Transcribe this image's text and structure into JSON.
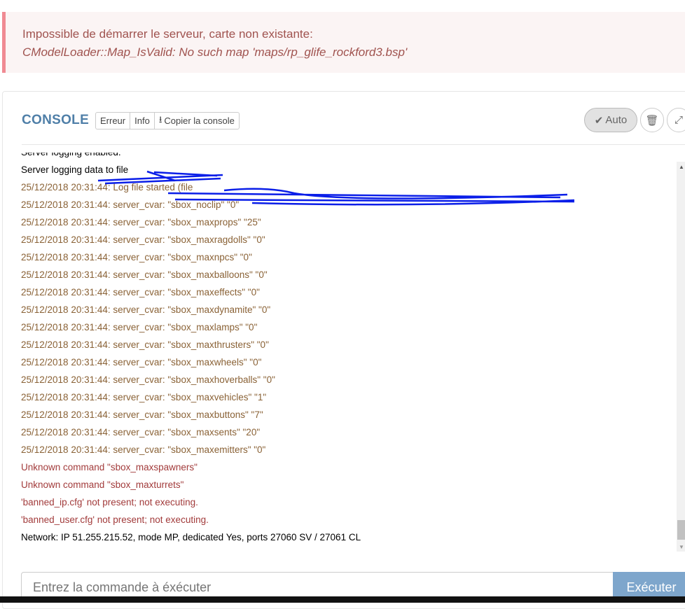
{
  "alert": {
    "message": "Impossible de démarrer le serveur, carte non existante:",
    "detail": "CModelLoader::Map_IsValid: No such map 'maps/rp_glife_rockford3.bsp'"
  },
  "console": {
    "title": "CONSOLE",
    "filters": {
      "error": "Erreur",
      "info": "Info",
      "copy": "Copier la console"
    },
    "auto_label": "Auto",
    "lines": [
      {
        "text": "Server logging enabled.",
        "type": "info"
      },
      {
        "text": "Server logging data to file",
        "type": "info"
      },
      {
        "text": "25/12/2018 20:31:44: Log file started (file",
        "type": "warn"
      },
      {
        "text": "25/12/2018 20:31:44: server_cvar: \"sbox_noclip\" \"0\"",
        "type": "warn"
      },
      {
        "text": "25/12/2018 20:31:44: server_cvar: \"sbox_maxprops\" \"25\"",
        "type": "warn"
      },
      {
        "text": "25/12/2018 20:31:44: server_cvar: \"sbox_maxragdolls\" \"0\"",
        "type": "warn"
      },
      {
        "text": "25/12/2018 20:31:44: server_cvar: \"sbox_maxnpcs\" \"0\"",
        "type": "warn"
      },
      {
        "text": "25/12/2018 20:31:44: server_cvar: \"sbox_maxballoons\" \"0\"",
        "type": "warn"
      },
      {
        "text": "25/12/2018 20:31:44: server_cvar: \"sbox_maxeffects\" \"0\"",
        "type": "warn"
      },
      {
        "text": "25/12/2018 20:31:44: server_cvar: \"sbox_maxdynamite\" \"0\"",
        "type": "warn"
      },
      {
        "text": "25/12/2018 20:31:44: server_cvar: \"sbox_maxlamps\" \"0\"",
        "type": "warn"
      },
      {
        "text": "25/12/2018 20:31:44: server_cvar: \"sbox_maxthrusters\" \"0\"",
        "type": "warn"
      },
      {
        "text": "25/12/2018 20:31:44: server_cvar: \"sbox_maxwheels\" \"0\"",
        "type": "warn"
      },
      {
        "text": "25/12/2018 20:31:44: server_cvar: \"sbox_maxhoverballs\" \"0\"",
        "type": "warn"
      },
      {
        "text": "25/12/2018 20:31:44: server_cvar: \"sbox_maxvehicles\" \"1\"",
        "type": "warn"
      },
      {
        "text": "25/12/2018 20:31:44: server_cvar: \"sbox_maxbuttons\" \"7\"",
        "type": "warn"
      },
      {
        "text": "25/12/2018 20:31:44: server_cvar: \"sbox_maxsents\" \"20\"",
        "type": "warn"
      },
      {
        "text": "25/12/2018 20:31:44: server_cvar: \"sbox_maxemitters\" \"0\"",
        "type": "warn"
      },
      {
        "text": "Unknown command \"sbox_maxspawners\"",
        "type": "err"
      },
      {
        "text": "Unknown command \"sbox_maxturrets\"",
        "type": "err"
      },
      {
        "text": "'banned_ip.cfg' not present; not executing.",
        "type": "err"
      },
      {
        "text": "'banned_user.cfg' not present; not executing.",
        "type": "err"
      },
      {
        "text": "Network: IP 51.255.215.52, mode MP, dedicated Yes, ports 27060 SV / 27061 CL",
        "type": "info"
      }
    ],
    "input_placeholder": "Entrez la commande à éxécuter",
    "execute_label": "Exécuter"
  },
  "colors": {
    "info": "#2f6a8f",
    "warn": "#8a6236",
    "err": "#a23b3b",
    "accent": "#7ea6cc",
    "redaction": "#0a1ee8"
  },
  "icons": [
    "check-icon",
    "trash-icon",
    "expand-icon",
    "download-icon"
  ]
}
